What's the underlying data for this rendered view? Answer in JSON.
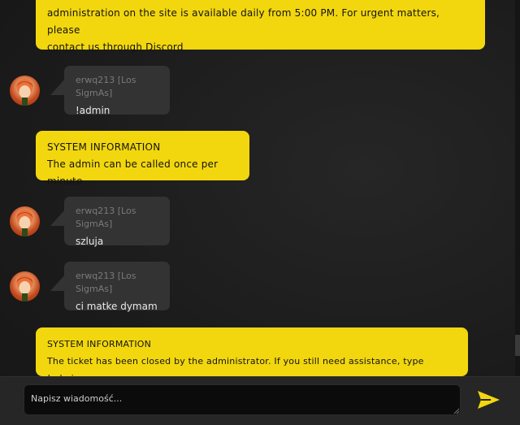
{
  "system_label": "SYSTEM INFORMATION",
  "messages": [
    {
      "type": "system",
      "text_line1": "administration on the site is available daily from 5:00 PM. For urgent matters, please",
      "text_line2": "contact us through Discord"
    },
    {
      "type": "user",
      "username": "erwq213 [Los SigmAs]",
      "text": "!admin"
    },
    {
      "type": "system",
      "title": "SYSTEM INFORMATION",
      "text": "The admin can be called once per minute"
    },
    {
      "type": "user",
      "username": "erwq213 [Los SigmAs]",
      "text": "szluja"
    },
    {
      "type": "user",
      "username": "erwq213 [Los SigmAs]",
      "text": "ci matke dymam"
    },
    {
      "type": "system",
      "title": "SYSTEM INFORMATION",
      "text": "The ticket has been closed by the administrator. If you still need assistance, type !admin"
    }
  ],
  "composer": {
    "placeholder": "Napisz wiadomość...",
    "send_icon": "send-icon"
  },
  "colors": {
    "system_bg": "#f2d70e",
    "user_bubble": "#333333",
    "accent": "#f2d70e"
  }
}
